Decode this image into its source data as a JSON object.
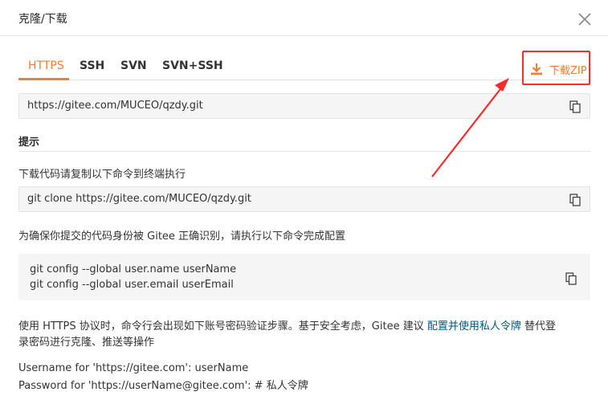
{
  "dialog": {
    "title": "克隆/下载"
  },
  "tabs": [
    {
      "label": "HTTPS",
      "active": true
    },
    {
      "label": "SSH",
      "active": false
    },
    {
      "label": "SVN",
      "active": false
    },
    {
      "label": "SVN+SSH",
      "active": false
    }
  ],
  "download": {
    "label": "下载ZIP"
  },
  "repo_url": "https://gitee.com/MUCEO/qzdy.git",
  "tip": {
    "title": "提示",
    "clone_hint": "下载代码请复制以下命令到终端执行",
    "clone_command": "git clone https://gitee.com/MUCEO/qzdy.git",
    "config_hint": "为确保你提交的代码身份被 Gitee 正确识别，请执行以下命令完成配置",
    "config_line1": "git config --global user.name userName",
    "config_line2": "git config --global user.email userEmail",
    "https_note_pre": "使用 HTTPS 协议时，命令行会出现如下账号密码验证步骤。基于安全考虑，Gitee 建议",
    "https_note_link": "配置并使用私人令牌",
    "https_note_post": "替代登",
    "https_note_line2": "录密码进行克隆、推送等操作",
    "username_line": "Username for 'https://gitee.com': userName",
    "password_line": "Password for 'https://userName@gitee.com': # 私人令牌"
  },
  "colors": {
    "accent": "#f77c33",
    "annotation": "#ff2a2a",
    "link": "#005980"
  },
  "icons": {
    "close": "close-icon",
    "download": "download-icon",
    "copy": "copy-icon"
  }
}
